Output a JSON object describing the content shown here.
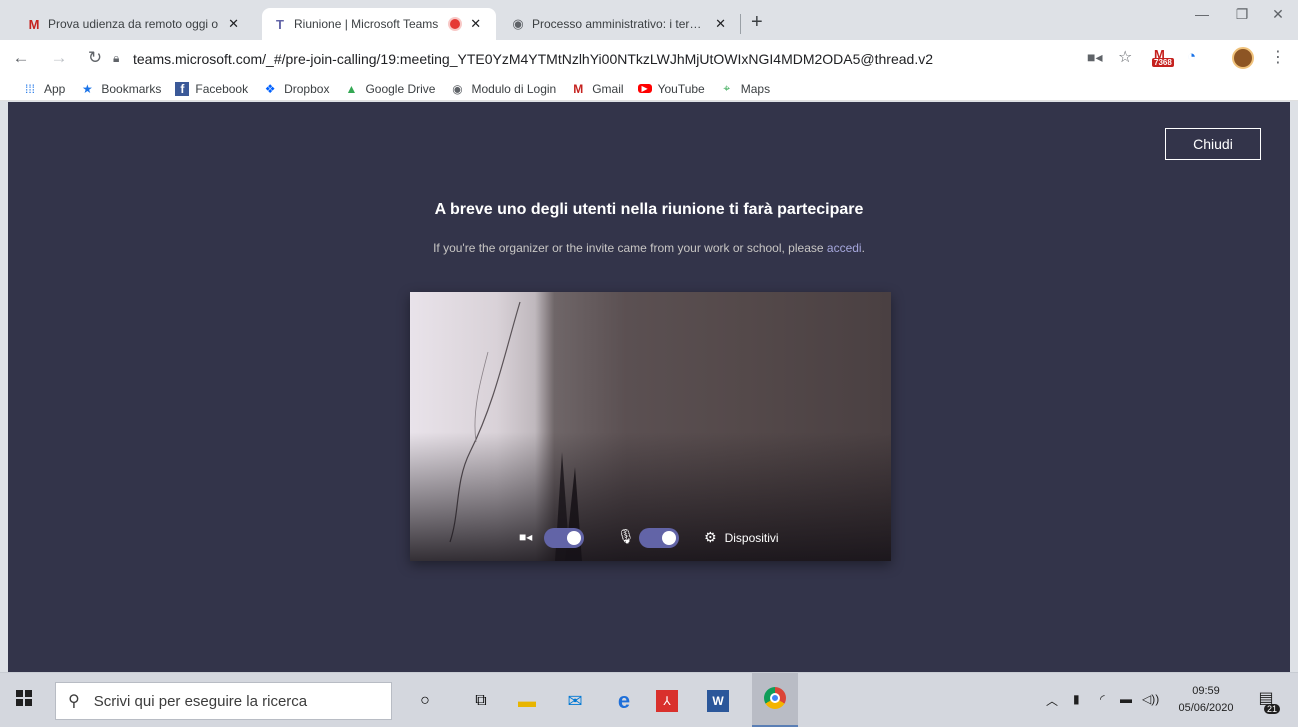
{
  "browser": {
    "tabs": [
      {
        "title": "Prova udienza da remoto oggi o",
        "favicon": "gmail-icon",
        "active": false
      },
      {
        "title": "Riunione | Microsoft Teams",
        "favicon": "teams-icon",
        "active": true,
        "recording": true
      },
      {
        "title": "Processo amministrativo: i termin",
        "favicon": "globe-icon",
        "active": false
      }
    ],
    "address_url": "teams.microsoft.com/_#/pre-join-calling/19:meeting_YTE0YzM4YTMtNzlhYi00NTkzLWJhMjUtOWIxNGI4MDM2ODA5@thread.v2",
    "gmail_badge": "7368",
    "bookmarks": [
      {
        "label": "App",
        "icon": "apps-grid-icon"
      },
      {
        "label": "Bookmarks",
        "icon": "star-icon"
      },
      {
        "label": "Facebook",
        "icon": "facebook-icon"
      },
      {
        "label": "Dropbox",
        "icon": "dropbox-icon"
      },
      {
        "label": "Google Drive",
        "icon": "google-drive-icon"
      },
      {
        "label": "Modulo di Login",
        "icon": "globe-icon"
      },
      {
        "label": "Gmail",
        "icon": "gmail-icon"
      },
      {
        "label": "YouTube",
        "icon": "youtube-icon"
      },
      {
        "label": "Maps",
        "icon": "maps-icon"
      }
    ]
  },
  "teams": {
    "close_label": "Chiudi",
    "headline": "A breve uno degli utenti nella riunione ti farà partecipare",
    "subline_text": "If you're the organizer or the invite came from your work or school, please ",
    "subline_link": "accedi",
    "subline_end": ".",
    "devices_label": "Dispositivi",
    "camera_on": true,
    "mic_on": true
  },
  "taskbar": {
    "search_placeholder": "Scrivi qui per eseguire la ricerca",
    "time": "09:59",
    "date": "05/06/2020",
    "notifications": "21"
  },
  "colors": {
    "teams_bg": "#33344a",
    "teams_accent": "#6264a7",
    "link": "#a6a7dc"
  }
}
